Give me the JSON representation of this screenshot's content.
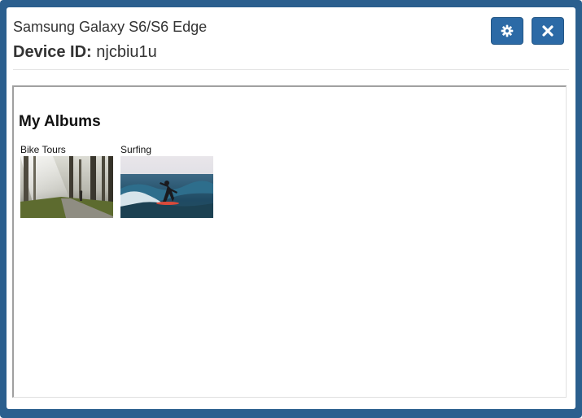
{
  "header": {
    "device_name": "Samsung Galaxy S6/S6 Edge",
    "device_id_label": "Device ID:",
    "device_id_value": "njcbiu1u"
  },
  "toolbar": {
    "settings_icon": "gear-icon",
    "close_icon": "close-icon"
  },
  "content": {
    "title": "My Albums",
    "albums": [
      {
        "label": "Bike Tours",
        "thumbnail": "forest-road-photo"
      },
      {
        "label": "Surfing",
        "thumbnail": "surfer-wave-photo"
      }
    ]
  },
  "colors": {
    "frame": "#2b5f8e",
    "button": "#2c6aa6"
  }
}
